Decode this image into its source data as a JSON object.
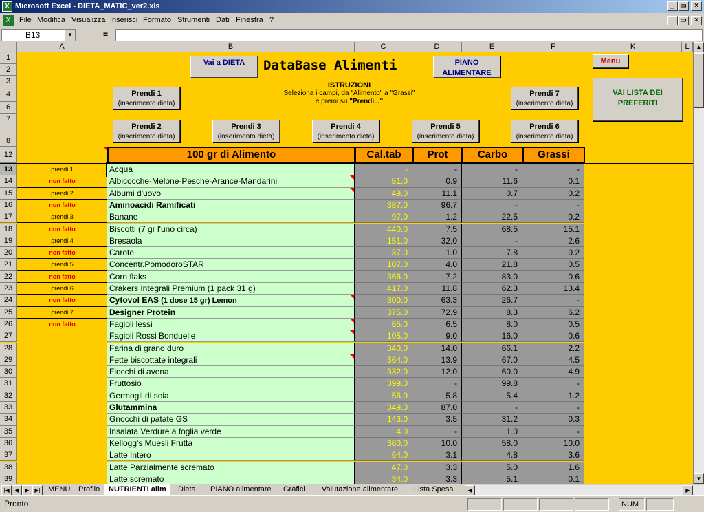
{
  "app": {
    "title": "Microsoft Excel - DIETA_MATIC_ver2.xls",
    "icon": "excel-icon",
    "win_min": "_",
    "win_max": "▭",
    "win_close": "×"
  },
  "menu": [
    "File",
    "Modifica",
    "Visualizza",
    "Inserisci",
    "Formato",
    "Strumenti",
    "Dati",
    "Finestra",
    "?"
  ],
  "formula_bar": {
    "name_box": "B13",
    "equals": "=",
    "value": ""
  },
  "columns": [
    "A",
    "B",
    "C",
    "D",
    "E",
    "F",
    "K",
    "L"
  ],
  "header_rows": [
    "1",
    "2",
    "3",
    "4",
    "6",
    "7",
    "8",
    "12"
  ],
  "buttons": {
    "vai_dieta": "Vai a DIETA",
    "piano": "PIANO ALIMENTARE",
    "menu": "Menu",
    "vai_preferiti": "VAI LISTA DEI PREFERITI",
    "prendi_sub": "(inserimento dieta)",
    "prendi": [
      "Prendi 1",
      "Prendi 2",
      "Prendi 3",
      "Prendi 4",
      "Prendi 5",
      "Prendi 6",
      "Prendi 7"
    ]
  },
  "db_title": "DataBase Alimenti",
  "instructions": {
    "heading": "ISTRUZIONI",
    "line1a": "Seleziona i campi, da ",
    "line1b": "\"Alimento\"",
    "line1c": " a ",
    "line1d": "\"Grassi\"",
    "line2a": "e premi su ",
    "line2b": "\"Prendi...\""
  },
  "table_headers": {
    "name": "100 gr di Alimento",
    "cal": "Cal.tab",
    "prot": "Prot",
    "carbo": "Carbo",
    "grassi": "Grassi"
  },
  "status_labels": [
    "prendi 1",
    "non fatto",
    "prendi 2",
    "non fatto",
    "prendi 3",
    "non fatto",
    "prendi 4",
    "non fatto",
    "prendi 5",
    "non fatto",
    "prendi 6",
    "non fatto",
    "prendi 7",
    "non fatto"
  ],
  "rows": [
    {
      "n": "13",
      "name": "Acqua",
      "cal": "-",
      "prot": "-",
      "carbo": "-",
      "grassi": "-"
    },
    {
      "n": "14",
      "name": "Albicocche-Melone-Pesche-Arance-Mandarini",
      "cal": "51.0",
      "prot": "0.9",
      "carbo": "11.6",
      "grassi": "0.1"
    },
    {
      "n": "15",
      "name": "Albumi d'uovo",
      "cal": "49.0",
      "prot": "11.1",
      "carbo": "0.7",
      "grassi": "0.2"
    },
    {
      "n": "16",
      "name": "Aminoacidi Ramificati",
      "cal": "387.0",
      "prot": "96.7",
      "carbo": "-",
      "grassi": "-",
      "bold": true
    },
    {
      "n": "17",
      "name": "Banane",
      "cal": "97.0",
      "prot": "1.2",
      "carbo": "22.5",
      "grassi": "0.2"
    },
    {
      "n": "18",
      "name": "Biscotti (7 gr l'uno circa)",
      "cal": "440.0",
      "prot": "7.5",
      "carbo": "68.5",
      "grassi": "15.1"
    },
    {
      "n": "19",
      "name": "Bresaola",
      "cal": "151.0",
      "prot": "32.0",
      "carbo": "-",
      "grassi": "2.6"
    },
    {
      "n": "20",
      "name": "Carote",
      "cal": "37.0",
      "prot": "1.0",
      "carbo": "7.8",
      "grassi": "0.2"
    },
    {
      "n": "21",
      "name": "Concentr.PomodoroSTAR",
      "cal": "107.0",
      "prot": "4.0",
      "carbo": "21.8",
      "grassi": "0.5"
    },
    {
      "n": "22",
      "name": "Corn flaks",
      "cal": "366.0",
      "prot": "7.2",
      "carbo": "83.0",
      "grassi": "0.6"
    },
    {
      "n": "23",
      "name": "Crakers Integrali Premium (1 pack 31 g)",
      "cal": "417.0",
      "prot": "11.8",
      "carbo": "62.3",
      "grassi": "13.4"
    },
    {
      "n": "24",
      "name": "Cytovol EAS",
      "name_sub": " (1 dose 15 gr) Lemon",
      "cal": "300.0",
      "prot": "63.3",
      "carbo": "26.7",
      "grassi": "-",
      "bold": true
    },
    {
      "n": "25",
      "name": "Designer Protein",
      "cal": "375.0",
      "prot": "72.9",
      "carbo": "8.3",
      "grassi": "6.2",
      "bold": true
    },
    {
      "n": "26",
      "name": "Fagioli lessi",
      "cal": "65.0",
      "prot": "6.5",
      "carbo": "8.0",
      "grassi": "0.5"
    },
    {
      "n": "27",
      "name": "Fagioli Rossi Bonduelle",
      "cal": "105.0",
      "prot": "9.0",
      "carbo": "16.0",
      "grassi": "0.6"
    },
    {
      "n": "28",
      "name": "Farina di grano duro",
      "cal": "340.0",
      "prot": "14.0",
      "carbo": "66.1",
      "grassi": "2.2"
    },
    {
      "n": "29",
      "name": "Fette biscottate integrali",
      "cal": "364.0",
      "prot": "13.9",
      "carbo": "67.0",
      "grassi": "4.5"
    },
    {
      "n": "30",
      "name": "Fiocchi di avena",
      "cal": "332.0",
      "prot": "12.0",
      "carbo": "60.0",
      "grassi": "4.9"
    },
    {
      "n": "31",
      "name": "Fruttosio",
      "cal": "399.0",
      "prot": "-",
      "carbo": "99.8",
      "grassi": "-"
    },
    {
      "n": "32",
      "name": "Germogli di soia",
      "cal": "56.0",
      "prot": "5.8",
      "carbo": "5.4",
      "grassi": "1.2"
    },
    {
      "n": "33",
      "name": "Glutammina",
      "cal": "349.0",
      "prot": "87.0",
      "carbo": "-",
      "grassi": "-",
      "bold": true
    },
    {
      "n": "34",
      "name": "Gnocchi di patate GS",
      "cal": "143.0",
      "prot": "3.5",
      "carbo": "31.2",
      "grassi": "0.3"
    },
    {
      "n": "35",
      "name": "Insalata Verdure a foglia verde",
      "cal": "4.0",
      "prot": "-",
      "carbo": "1.0",
      "grassi": "-"
    },
    {
      "n": "36",
      "name": "Kellogg's Muesli Frutta",
      "cal": "360.0",
      "prot": "10.0",
      "carbo": "58.0",
      "grassi": "10.0"
    },
    {
      "n": "37",
      "name": "Latte Intero",
      "cal": "64.0",
      "prot": "3.1",
      "carbo": "4.8",
      "grassi": "3.6"
    },
    {
      "n": "38",
      "name": "Latte Parzialmente scremato",
      "cal": "47.0",
      "prot": "3.3",
      "carbo": "5.0",
      "grassi": "1.6"
    },
    {
      "n": "39",
      "name": "Latte scremato",
      "cal": "34.0",
      "prot": "3.3",
      "carbo": "5.1",
      "grassi": "0.1"
    }
  ],
  "tabs": [
    "MENU",
    "Profilo",
    "NUTRIENTI alim",
    "Dieta",
    "PIANO alimentare",
    "Grafici",
    "Valutazione alimentare",
    "Lista Spesa"
  ],
  "active_tab": "NUTRIENTI alim",
  "status": {
    "left": "Pronto",
    "num": "NUM"
  }
}
